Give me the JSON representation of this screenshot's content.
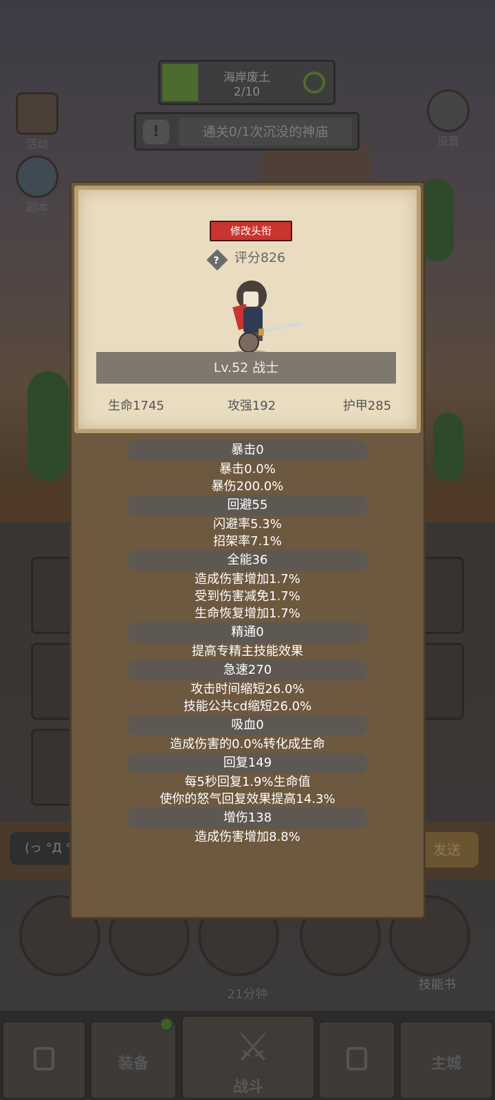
{
  "level": {
    "name": "海岸废土",
    "progress": "2/10"
  },
  "quest": {
    "alert_icon": "!",
    "text": "通关0/1次沉没的神庙"
  },
  "side_buttons": {
    "activity": "活动",
    "dungeon": "副本",
    "settings": "设置"
  },
  "chat": {
    "input_value": "(っ °Д °",
    "send_label": "发送"
  },
  "chest_timer": "21分钟",
  "skill_book": "技能书",
  "nav": {
    "equipment": "装备",
    "battle": "战斗",
    "main_city": "主城"
  },
  "profile": {
    "rename_button": "修改头衔",
    "help_icon": "?",
    "score": "评分826",
    "level_class": "Lv.52 战士",
    "hp": "生命1745",
    "attack": "攻强192",
    "armor": "护甲285"
  },
  "stats": [
    {
      "header": "暴击0",
      "lines": [
        "暴击0.0%",
        "暴伤200.0%"
      ]
    },
    {
      "header": "回避55",
      "lines": [
        "闪避率5.3%",
        "招架率7.1%"
      ]
    },
    {
      "header": "全能36",
      "lines": [
        "造成伤害增加1.7%",
        "受到伤害减免1.7%",
        "生命恢复增加1.7%"
      ]
    },
    {
      "header": "精通0",
      "lines": [
        "提高专精主技能效果"
      ]
    },
    {
      "header": "急速270",
      "lines": [
        "攻击时间缩短26.0%",
        "技能公共cd缩短26.0%"
      ]
    },
    {
      "header": "吸血0",
      "lines": [
        "造成伤害的0.0%转化成生命"
      ]
    },
    {
      "header": "回复149",
      "lines": [
        "每5秒回复1.9%生命值",
        "使你的怒气回复效果提高14.3%"
      ]
    },
    {
      "header": "增伤138",
      "lines": [
        "造成伤害增加8.8%"
      ]
    }
  ],
  "colors": {
    "rename_red": "#c9342e",
    "panel_brown": "#6d5840",
    "card_paper": "#e9dcc0"
  }
}
